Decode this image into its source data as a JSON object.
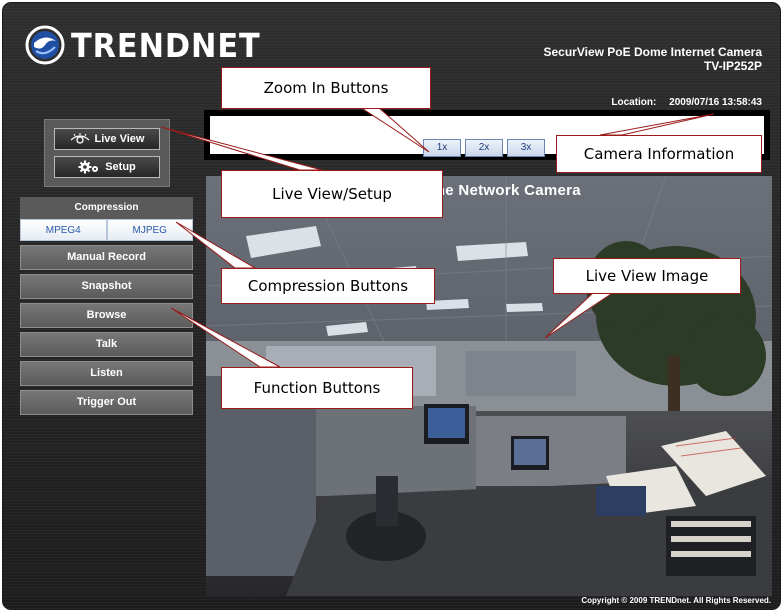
{
  "header": {
    "logo_text": "TRENDNET",
    "product_name": "SecurView PoE Dome Internet Camera",
    "model": "TV-IP252P",
    "location_label": "Location:",
    "datetime": "2009/07/16 13:58:43"
  },
  "zoom": {
    "buttons": [
      "1x",
      "2x",
      "3x"
    ]
  },
  "mode": {
    "live_view_label": "Live View",
    "setup_label": "Setup"
  },
  "compression": {
    "heading": "Compression",
    "options": [
      "MPEG4",
      "MJPEG"
    ]
  },
  "functions": [
    "Manual Record",
    "Snapshot",
    "Browse",
    "Talk",
    "Listen",
    "Trigger Out"
  ],
  "live_view": {
    "overlay_title": "d Dome Network Camera"
  },
  "footer": {
    "copyright": "Copyright © 2009 TRENDnet. All Rights Reserved."
  },
  "callouts": {
    "zoom_in": "Zoom In Buttons",
    "camera_info": "Camera Information",
    "live_view_setup": "Live View/Setup",
    "compression": "Compression Buttons",
    "live_image": "Live View Image",
    "function": "Function Buttons"
  },
  "colors": {
    "callout_border": "#9b1b1b",
    "button_text": "#2a5aa8",
    "panel_gray": "#5a5a5a"
  },
  "icons": [
    "trendnet-logo-icon",
    "eye-icon",
    "gear-icon"
  ]
}
